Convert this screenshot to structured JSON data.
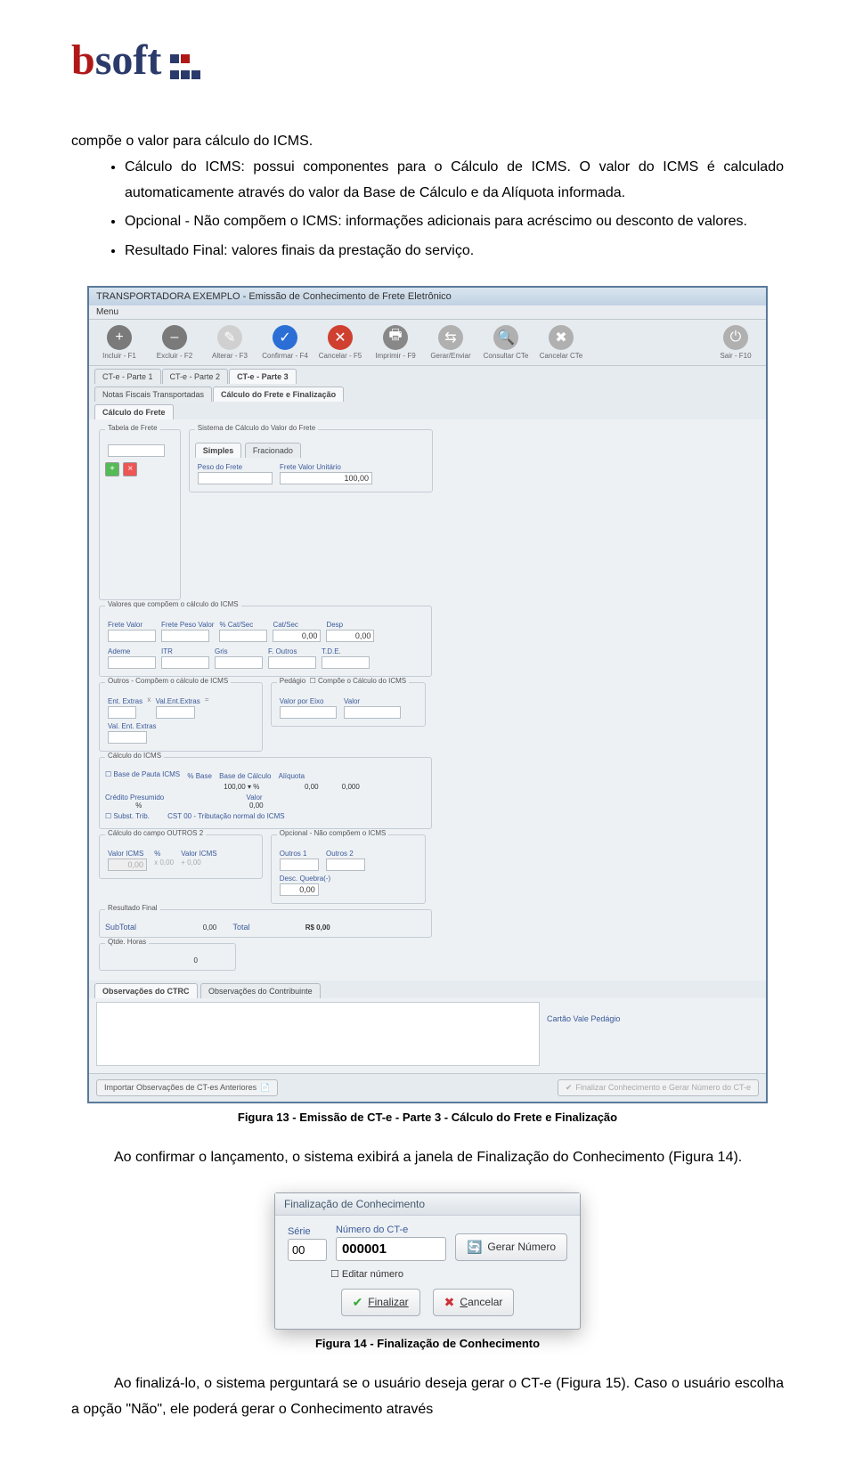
{
  "logo": {
    "b": "b",
    "soft": "soft"
  },
  "intro_continuation": "compõe o valor para cálculo do ICMS.",
  "bullets": [
    "Cálculo do ICMS: possui componentes para o Cálculo de ICMS. O valor do ICMS é calculado automaticamente através do valor da Base de Cálculo e da Alíquota informada.",
    "Opcional - Não compõem o ICMS: informações adicionais para acréscimo ou desconto de valores.",
    "Resultado Final: valores finais da prestação do serviço."
  ],
  "screenshot": {
    "title": "TRANSPORTADORA EXEMPLO - Emissão de Conhecimento de Frete Eletrônico",
    "menu": "Menu",
    "toolbar": [
      {
        "icon": "+",
        "cls": "ico-plus",
        "label": "Incluir - F1"
      },
      {
        "icon": "–",
        "cls": "ico-minus",
        "label": "Excluir - F2"
      },
      {
        "icon": "✎",
        "cls": "ico-edit",
        "label": "Alterar - F3"
      },
      {
        "icon": "✓",
        "cls": "ico-ok",
        "label": "Confirmar - F4"
      },
      {
        "icon": "✕",
        "cls": "ico-cancel",
        "label": "Cancelar - F5"
      },
      {
        "icon": "🖶",
        "cls": "ico-print",
        "label": "Imprimir - F9"
      },
      {
        "icon": "⇆",
        "cls": "ico-gen",
        "label": "Gerar/Enviar"
      },
      {
        "icon": "🔍",
        "cls": "ico-gen",
        "label": "Consultar CTe"
      },
      {
        "icon": "✖",
        "cls": "ico-gen",
        "label": "Cancelar CTe"
      },
      {
        "icon": "⏻",
        "cls": "ico-gen",
        "label": "Sair - F10"
      }
    ],
    "tabs1": [
      "CT-e - Parte 1",
      "CT-e - Parte 2",
      "CT-e - Parte 3"
    ],
    "tabs2": [
      "Notas Fiscais Transportadas",
      "Cálculo do Frete e Finalização"
    ],
    "tabs3": [
      "Cálculo do Frete"
    ],
    "tabela_frete_title": "Tabela de Frete",
    "sistema": {
      "title": "Sistema de Cálculo do Valor do Frete",
      "tabs": [
        "Simples",
        "Fracionado"
      ],
      "peso_label": "Peso do Frete",
      "unit_label": "Frete Valor Unitário",
      "unit_value": "100,00"
    },
    "valores_icms": {
      "title": "Valores que compõem o cálculo do ICMS",
      "cols": [
        "Frete Valor",
        "Frete Peso Valor",
        "% Cat/Sec",
        "Cat/Sec",
        "Desp"
      ],
      "vals": [
        "",
        "",
        "",
        "0,00",
        "0,00"
      ],
      "cols2": [
        "Ademe",
        "ITR",
        "Gris",
        "F. Outros",
        "T.D.E."
      ]
    },
    "outros": {
      "title": "Outros - Compõem o cálculo de ICMS",
      "cols": [
        "Ent. Extras",
        "Val.Ent.Extras",
        "Val. Ent. Extras"
      ],
      "x": "x",
      "eq": "="
    },
    "pedagio": {
      "title": "Pedágio",
      "chk": "Compõe o Cálculo do ICMS",
      "cols": [
        "Valor por Eixo",
        "Valor"
      ]
    },
    "calculo_icms": {
      "title": "Cálculo do ICMS",
      "chk": "Base de Pauta ICMS",
      "cols": [
        "% Base",
        "",
        "Base de Cálculo",
        "Alíquota"
      ],
      "vals": [
        "100,00 ▾",
        "%",
        "0,00",
        "0,000"
      ],
      "credito": "Crédito Presumido",
      "pct": "%",
      "valor": "Valor",
      "valor_v": "0,00",
      "subst": "Subst. Trib.",
      "cst_lbl": "CST",
      "cst_val": "00 - Tributação normal do ICMS"
    },
    "outros2": {
      "title": "Cálculo do campo OUTROS 2",
      "cols": [
        "Valor ICMS",
        "%",
        "Valor ICMS"
      ],
      "vals": [
        "0,00",
        "x   0,00",
        "+   0,00"
      ]
    },
    "opcional": {
      "title": "Opcional - Não compõem o ICMS",
      "cols": [
        "Outros 1",
        "Outros 2",
        "Desc. Quebra(-)"
      ],
      "val": "0,00"
    },
    "qtde": {
      "title": "Qtde. Horas",
      "val": "0"
    },
    "resultado": {
      "title": "Resultado Final",
      "sub": "SubTotal",
      "sub_v": "0,00",
      "tot": "Total",
      "tot_v": "R$ 0,00"
    },
    "obs_tabs": [
      "Observações do CTRC",
      "Observações do Contribuinte"
    ],
    "cartao": "Cartão Vale Pedágio",
    "btn_import": "Importar Observações de CT-es Anteriores",
    "btn_finalizar": "Finalizar Conhecimento e Gerar Número do CT-e"
  },
  "caption1": "Figura 13 - Emissão de CT-e - Parte 3 - Cálculo do Frete e Finalização",
  "para_after1": "Ao confirmar o lançamento, o sistema exibirá a janela de Finalização do Conhecimento (Figura 14).",
  "dialog": {
    "title": "Finalização de Conhecimento",
    "serie_lbl": "Série",
    "serie_val": "00",
    "numero_lbl": "Número do CT-e",
    "numero_val": "000001",
    "gerar": "Gerar Número",
    "editar": "Editar número",
    "finalizar": "Finalizar",
    "cancelar": "Cancelar"
  },
  "caption2": "Figura 14 - Finalização de Conhecimento",
  "para_last": "Ao finalizá-lo, o sistema perguntará se o usuário deseja gerar o CT-e (Figura 15). Caso o usuário escolha a opção \"Não\", ele poderá gerar o Conhecimento através"
}
